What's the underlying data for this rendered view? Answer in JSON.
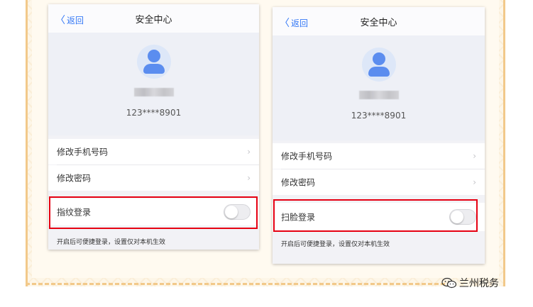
{
  "screens": [
    {
      "nav": {
        "back_label": "返回",
        "title": "安全中心"
      },
      "profile": {
        "phone": "123****8901"
      },
      "rows": {
        "change_phone": "修改手机号码",
        "change_password": "修改密码"
      },
      "login_option": {
        "label": "指纹登录",
        "enabled": false
      },
      "hint": "开启后可便捷登录，设置仅对本机生效"
    },
    {
      "nav": {
        "back_label": "返回",
        "title": "安全中心"
      },
      "profile": {
        "phone": "123****8901"
      },
      "rows": {
        "change_phone": "修改手机号码",
        "change_password": "修改密码"
      },
      "login_option": {
        "label": "扫脸登录",
        "enabled": false
      },
      "hint": "开启后可便捷登录，设置仅对本机生效"
    }
  ],
  "watermark": {
    "text": "兰州税务",
    "icon": "wechat-icon"
  },
  "colors": {
    "accent": "#3478f6",
    "highlight": "#e60012",
    "frame": "#f2c98a"
  }
}
